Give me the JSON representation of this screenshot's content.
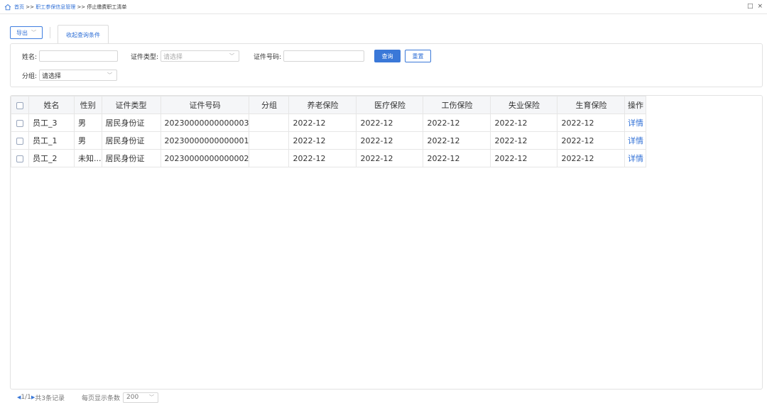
{
  "breadcrumb": {
    "home": "首页",
    "sep1": ">>",
    "module": "职工参保信息管理",
    "sep2": ">>",
    "current": "停止缴费职工清单"
  },
  "window": {
    "restore": "□",
    "close": "×"
  },
  "toolbar": {
    "export_label": "导出",
    "collapse_tab_label": "收起查询条件"
  },
  "query": {
    "name_label": "姓名:",
    "name_value": "",
    "id_type_label": "证件类型:",
    "id_type_placeholder": "请选择",
    "id_number_label": "证件号码:",
    "id_number_value": "",
    "query_button": "查询",
    "reset_button": "重置",
    "group_label": "分组:",
    "group_value": "请选择"
  },
  "table": {
    "columns": [
      "姓名",
      "性别",
      "证件类型",
      "证件号码",
      "分组",
      "养老保险",
      "医疗保险",
      "工伤保险",
      "失业保险",
      "生育保险",
      "操作"
    ],
    "rows": [
      {
        "name": "员工_3",
        "gender": "男",
        "id_type": "居民身份证",
        "id_number": "20230000000000003",
        "group": "",
        "pension": "2022-12",
        "medical": "2022-12",
        "injury": "2022-12",
        "unemployment": "2022-12",
        "maternity": "2022-12",
        "action": "详情"
      },
      {
        "name": "员工_1",
        "gender": "男",
        "id_type": "居民身份证",
        "id_number": "20230000000000001",
        "group": "",
        "pension": "2022-12",
        "medical": "2022-12",
        "injury": "2022-12",
        "unemployment": "2022-12",
        "maternity": "2022-12",
        "action": "详情"
      },
      {
        "name": "员工_2",
        "gender": "未知...",
        "id_type": "居民身份证",
        "id_number": "20230000000000002",
        "group": "",
        "pension": "2022-12",
        "medical": "2022-12",
        "injury": "2022-12",
        "unemployment": "2022-12",
        "maternity": "2022-12",
        "action": "详情"
      }
    ]
  },
  "pager": {
    "prev_icon": "◀",
    "page_info": "1/1",
    "next_icon": "▶",
    "total_text": "共3条记录",
    "page_size_label": "每页显示条数",
    "page_size_value": "200"
  },
  "colors": {
    "accent": "#3a78d8",
    "link": "#2f6fd6",
    "header_bg": "#f5f6f8"
  }
}
